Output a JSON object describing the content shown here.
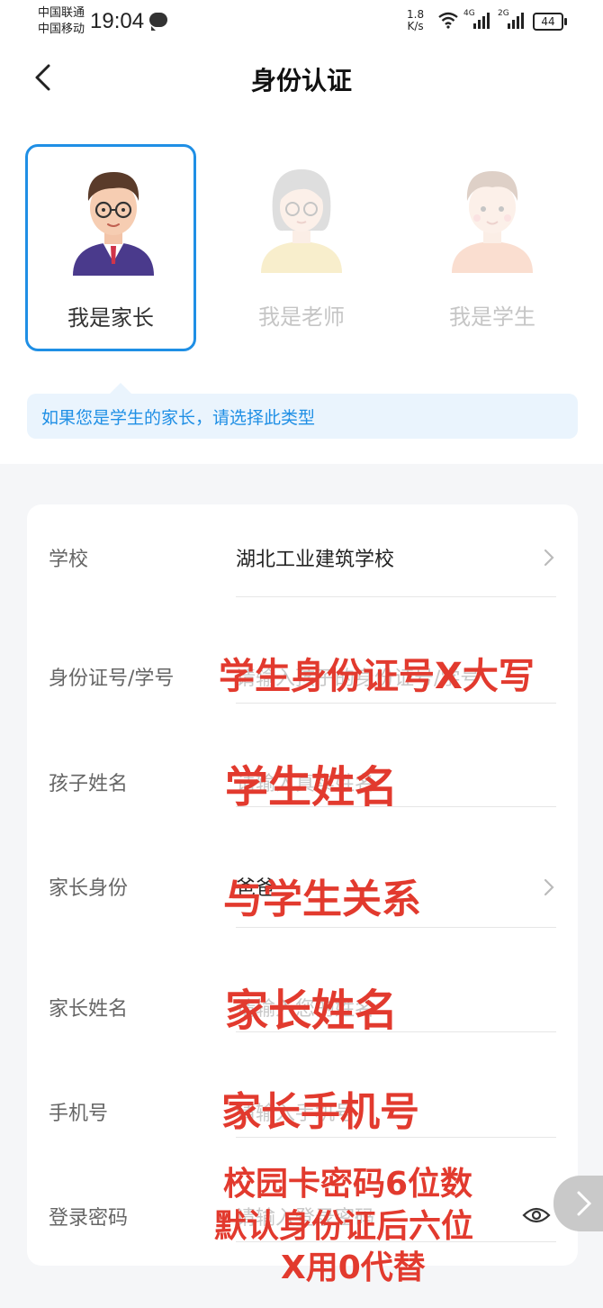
{
  "status_bar": {
    "carrier_1": "中国联通",
    "carrier_2": "中国移动",
    "time": "19:04",
    "speed_value": "1.8",
    "speed_unit": "K/s",
    "sim1_tag": "4G",
    "sim2_tag": "2G",
    "battery": "44"
  },
  "header": {
    "title": "身份认证"
  },
  "roles": [
    {
      "label": "我是家长",
      "selected": true
    },
    {
      "label": "我是老师",
      "selected": false
    },
    {
      "label": "我是学生",
      "selected": false
    }
  ],
  "hint": "如果您是学生的家长，请选择此类型",
  "form": {
    "school": {
      "label": "学校",
      "value": "湖北工业建筑学校"
    },
    "id_number": {
      "label": "身份证号/学号",
      "placeholder": "请输入孩子的身份证号/学号"
    },
    "child_name": {
      "label": "孩子姓名",
      "placeholder": "请输入真实姓名"
    },
    "parent_role": {
      "label": "家长身份",
      "value": "爸爸"
    },
    "parent_name": {
      "label": "家长姓名",
      "placeholder": "请输入您的姓名"
    },
    "phone": {
      "label": "手机号",
      "placeholder": "请输入手机号"
    },
    "password": {
      "label": "登录密码",
      "placeholder": "请输入登录密码"
    }
  },
  "annotations": {
    "id_number": "学生身份证号X大写",
    "child_name": "学生姓名",
    "parent_role": "与学生关系",
    "parent_name": "家长姓名",
    "phone": "家长手机号",
    "password_line1": "校园卡密码6位数",
    "password_line2": "默认身份证后六位",
    "password_line3": "X用0代替"
  },
  "colors": {
    "accent": "#1f8fe5",
    "annotation": "#e23a2e",
    "hint_bg": "#eaf4fd"
  }
}
